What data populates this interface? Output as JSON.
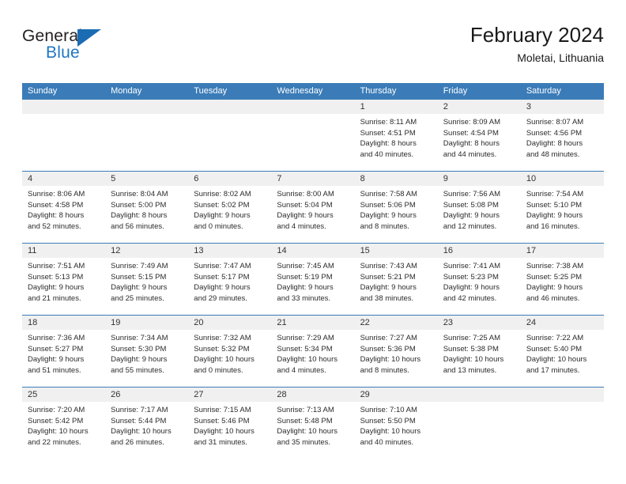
{
  "brand": {
    "word_one": "General",
    "word_two": "Blue",
    "flag_icon": "triangle-flag-icon"
  },
  "header": {
    "title": "February 2024",
    "subtitle": "Moletai, Lithuania"
  },
  "calendar": {
    "weekday_headers": [
      "Sunday",
      "Monday",
      "Tuesday",
      "Wednesday",
      "Thursday",
      "Friday",
      "Saturday"
    ],
    "colors": {
      "header_blue": "#3b7cb8",
      "daynum_band": "#f0f0f0",
      "brand_blue": "#1f76c2",
      "text": "#2b2b2b"
    },
    "weeks": [
      [
        {
          "day": "",
          "lines": []
        },
        {
          "day": "",
          "lines": []
        },
        {
          "day": "",
          "lines": []
        },
        {
          "day": "",
          "lines": []
        },
        {
          "day": "1",
          "lines": [
            "Sunrise: 8:11 AM",
            "Sunset: 4:51 PM",
            "Daylight: 8 hours",
            "and 40 minutes."
          ]
        },
        {
          "day": "2",
          "lines": [
            "Sunrise: 8:09 AM",
            "Sunset: 4:54 PM",
            "Daylight: 8 hours",
            "and 44 minutes."
          ]
        },
        {
          "day": "3",
          "lines": [
            "Sunrise: 8:07 AM",
            "Sunset: 4:56 PM",
            "Daylight: 8 hours",
            "and 48 minutes."
          ]
        }
      ],
      [
        {
          "day": "4",
          "lines": [
            "Sunrise: 8:06 AM",
            "Sunset: 4:58 PM",
            "Daylight: 8 hours",
            "and 52 minutes."
          ]
        },
        {
          "day": "5",
          "lines": [
            "Sunrise: 8:04 AM",
            "Sunset: 5:00 PM",
            "Daylight: 8 hours",
            "and 56 minutes."
          ]
        },
        {
          "day": "6",
          "lines": [
            "Sunrise: 8:02 AM",
            "Sunset: 5:02 PM",
            "Daylight: 9 hours",
            "and 0 minutes."
          ]
        },
        {
          "day": "7",
          "lines": [
            "Sunrise: 8:00 AM",
            "Sunset: 5:04 PM",
            "Daylight: 9 hours",
            "and 4 minutes."
          ]
        },
        {
          "day": "8",
          "lines": [
            "Sunrise: 7:58 AM",
            "Sunset: 5:06 PM",
            "Daylight: 9 hours",
            "and 8 minutes."
          ]
        },
        {
          "day": "9",
          "lines": [
            "Sunrise: 7:56 AM",
            "Sunset: 5:08 PM",
            "Daylight: 9 hours",
            "and 12 minutes."
          ]
        },
        {
          "day": "10",
          "lines": [
            "Sunrise: 7:54 AM",
            "Sunset: 5:10 PM",
            "Daylight: 9 hours",
            "and 16 minutes."
          ]
        }
      ],
      [
        {
          "day": "11",
          "lines": [
            "Sunrise: 7:51 AM",
            "Sunset: 5:13 PM",
            "Daylight: 9 hours",
            "and 21 minutes."
          ]
        },
        {
          "day": "12",
          "lines": [
            "Sunrise: 7:49 AM",
            "Sunset: 5:15 PM",
            "Daylight: 9 hours",
            "and 25 minutes."
          ]
        },
        {
          "day": "13",
          "lines": [
            "Sunrise: 7:47 AM",
            "Sunset: 5:17 PM",
            "Daylight: 9 hours",
            "and 29 minutes."
          ]
        },
        {
          "day": "14",
          "lines": [
            "Sunrise: 7:45 AM",
            "Sunset: 5:19 PM",
            "Daylight: 9 hours",
            "and 33 minutes."
          ]
        },
        {
          "day": "15",
          "lines": [
            "Sunrise: 7:43 AM",
            "Sunset: 5:21 PM",
            "Daylight: 9 hours",
            "and 38 minutes."
          ]
        },
        {
          "day": "16",
          "lines": [
            "Sunrise: 7:41 AM",
            "Sunset: 5:23 PM",
            "Daylight: 9 hours",
            "and 42 minutes."
          ]
        },
        {
          "day": "17",
          "lines": [
            "Sunrise: 7:38 AM",
            "Sunset: 5:25 PM",
            "Daylight: 9 hours",
            "and 46 minutes."
          ]
        }
      ],
      [
        {
          "day": "18",
          "lines": [
            "Sunrise: 7:36 AM",
            "Sunset: 5:27 PM",
            "Daylight: 9 hours",
            "and 51 minutes."
          ]
        },
        {
          "day": "19",
          "lines": [
            "Sunrise: 7:34 AM",
            "Sunset: 5:30 PM",
            "Daylight: 9 hours",
            "and 55 minutes."
          ]
        },
        {
          "day": "20",
          "lines": [
            "Sunrise: 7:32 AM",
            "Sunset: 5:32 PM",
            "Daylight: 10 hours",
            "and 0 minutes."
          ]
        },
        {
          "day": "21",
          "lines": [
            "Sunrise: 7:29 AM",
            "Sunset: 5:34 PM",
            "Daylight: 10 hours",
            "and 4 minutes."
          ]
        },
        {
          "day": "22",
          "lines": [
            "Sunrise: 7:27 AM",
            "Sunset: 5:36 PM",
            "Daylight: 10 hours",
            "and 8 minutes."
          ]
        },
        {
          "day": "23",
          "lines": [
            "Sunrise: 7:25 AM",
            "Sunset: 5:38 PM",
            "Daylight: 10 hours",
            "and 13 minutes."
          ]
        },
        {
          "day": "24",
          "lines": [
            "Sunrise: 7:22 AM",
            "Sunset: 5:40 PM",
            "Daylight: 10 hours",
            "and 17 minutes."
          ]
        }
      ],
      [
        {
          "day": "25",
          "lines": [
            "Sunrise: 7:20 AM",
            "Sunset: 5:42 PM",
            "Daylight: 10 hours",
            "and 22 minutes."
          ]
        },
        {
          "day": "26",
          "lines": [
            "Sunrise: 7:17 AM",
            "Sunset: 5:44 PM",
            "Daylight: 10 hours",
            "and 26 minutes."
          ]
        },
        {
          "day": "27",
          "lines": [
            "Sunrise: 7:15 AM",
            "Sunset: 5:46 PM",
            "Daylight: 10 hours",
            "and 31 minutes."
          ]
        },
        {
          "day": "28",
          "lines": [
            "Sunrise: 7:13 AM",
            "Sunset: 5:48 PM",
            "Daylight: 10 hours",
            "and 35 minutes."
          ]
        },
        {
          "day": "29",
          "lines": [
            "Sunrise: 7:10 AM",
            "Sunset: 5:50 PM",
            "Daylight: 10 hours",
            "and 40 minutes."
          ]
        },
        {
          "day": "",
          "lines": []
        },
        {
          "day": "",
          "lines": []
        }
      ]
    ]
  }
}
